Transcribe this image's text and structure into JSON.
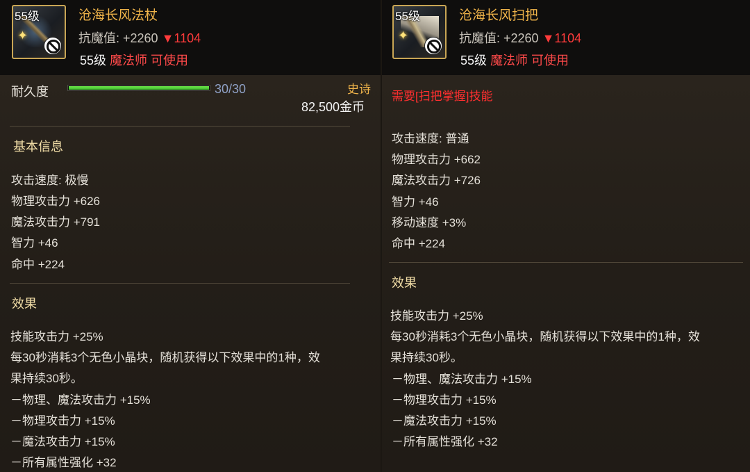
{
  "left": {
    "level_badge": "55级",
    "name": "沧海长风法杖",
    "resist_label": "抗魔值: ",
    "resist_value": "+2260",
    "resist_diff": "▼1104",
    "req_level": "55级",
    "req_class": "魔法师 可使用",
    "durability_label": "耐久度",
    "durability_text": "30/30",
    "durability_ratio": 1.0,
    "grade": "史诗",
    "price": "82,500金币",
    "basic_title": "基本信息",
    "stats": [
      "攻击速度: 极慢",
      "物理攻击力 +626",
      "魔法攻击力 +791",
      "智力 +46",
      "命中 +224"
    ],
    "effect_title": "效果",
    "effect_line1": "技能攻击力 +25%",
    "effect_line2a": "每30秒消耗3个无色小晶块，随机获得以下效果中的1种，效",
    "effect_line2b": "果持续30秒。",
    "effect_options": [
      "－物理、魔法攻击力 +15%",
      "－物理攻击力 +15%",
      "－魔法攻击力 +15%",
      "－所有属性强化 +32"
    ]
  },
  "right": {
    "level_badge": "55级",
    "name": "沧海长风扫把",
    "resist_label": "抗魔值: ",
    "resist_value": "+2260",
    "resist_diff": "▼1104",
    "req_level": "55级",
    "req_class": "魔法师 可使用",
    "skill_req": "需要[扫把掌握]技能",
    "stats": [
      "攻击速度: 普通",
      "物理攻击力 +662",
      "魔法攻击力 +726",
      "智力 +46",
      "移动速度 +3%",
      "命中 +224"
    ],
    "effect_title": "效果",
    "effect_line1": "技能攻击力 +25%",
    "effect_line2a": "每30秒消耗3个无色小晶块，随机获得以下效果中的1种，效",
    "effect_line2b": "果持续30秒。",
    "effect_options": [
      "－物理、魔法攻击力 +15%",
      "－物理攻击力 +15%",
      "－魔法攻击力 +15%",
      "－所有属性强化 +32"
    ]
  },
  "colors": {
    "item_name": "#f0b44a",
    "down_arrow": "#ff3b3b",
    "class_req": "#ff4a4a",
    "durability_fill": "#4ccf36",
    "skill_requirement": "#ff2f2f"
  },
  "icons": {
    "left_item": "staff-icon",
    "right_item": "broom-icon",
    "unusable": "prohibited-icon"
  }
}
